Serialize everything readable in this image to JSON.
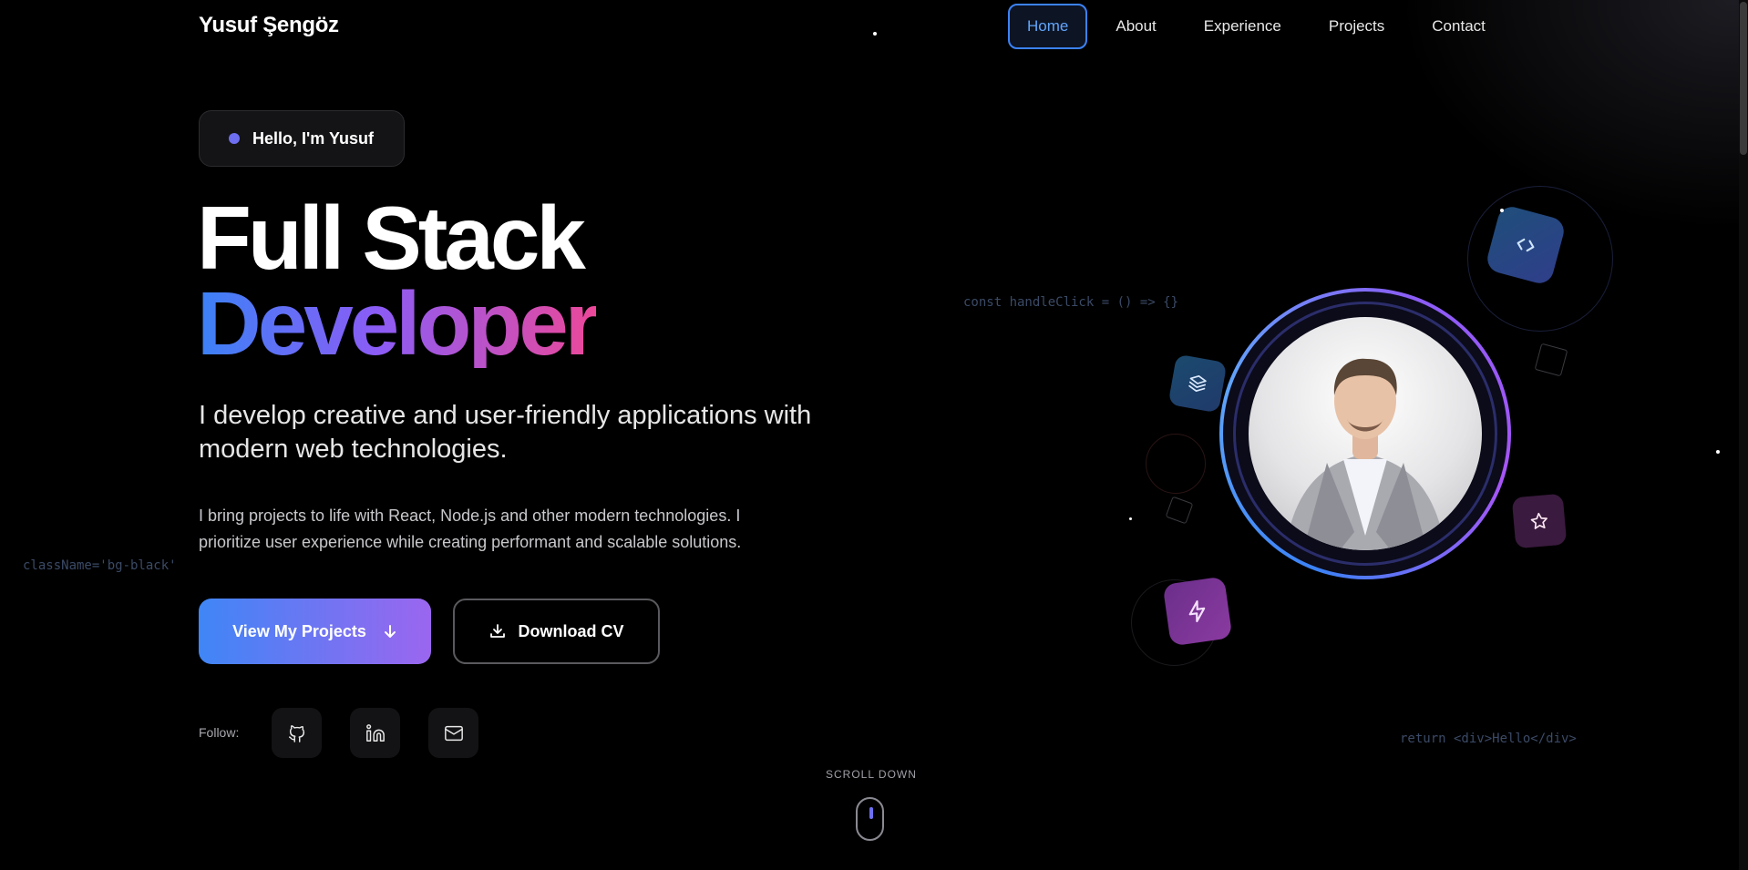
{
  "header": {
    "logo": "Yusuf Şengöz",
    "nav": [
      "Home",
      "About",
      "Experience",
      "Projects",
      "Contact"
    ],
    "active_nav": "Home"
  },
  "hero": {
    "badge": "Hello, I'm Yusuf",
    "title_line1": "Full Stack",
    "title_line2": "Developer",
    "lead": "I develop creative and user-friendly applications with modern web technologies.",
    "description": "I bring projects to life with React, Node.js and other modern technologies. I prioritize user experience while creating performant and scalable solutions.",
    "primary_button": "View My Projects",
    "secondary_button": "Download CV",
    "follow_label": "Follow:",
    "scroll_label": "SCROLL DOWN"
  },
  "code_snippets": {
    "left": "className='bg-black'",
    "top": "const handleClick = () => {}",
    "bottom": "return <div>Hello</div>"
  },
  "socials": [
    {
      "icon": "github-icon"
    },
    {
      "icon": "linkedin-icon"
    },
    {
      "icon": "mail-icon"
    }
  ],
  "colors": {
    "accent_blue": "#3b82f6",
    "accent_purple": "#8b5cf6",
    "accent_pink": "#ec4899"
  }
}
